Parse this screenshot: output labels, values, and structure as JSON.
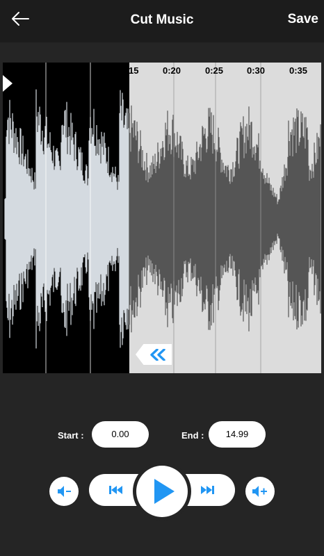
{
  "header": {
    "title": "Cut Music",
    "save_label": "Save"
  },
  "timeline": {
    "labels": [
      "15",
      "0:20",
      "0:25",
      "0:30",
      "0:35"
    ]
  },
  "selection": {
    "start_label": "Start :",
    "start_value": "0.00",
    "end_label": "End :",
    "end_value": "14.99"
  },
  "controls": {
    "volume_down_icon": "volume-down-icon",
    "previous_icon": "skip-previous-icon",
    "play_icon": "play-icon",
    "next_icon": "skip-next-icon",
    "volume_up_icon": "volume-up-icon"
  },
  "colors": {
    "accent": "#2196f3",
    "background": "#252525",
    "topbar": "#1c1c1c",
    "selected_wave": "#d4dae0",
    "unselected_bg": "#dcdcdc",
    "unselected_wave": "#555555"
  }
}
